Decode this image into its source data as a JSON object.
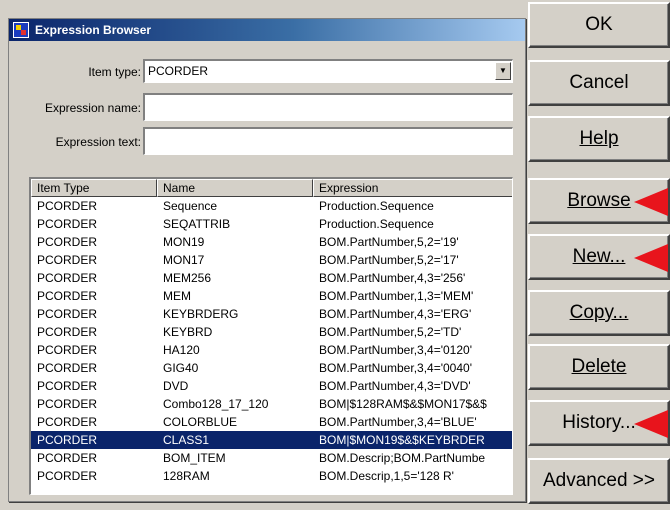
{
  "window": {
    "title": "Expression Browser"
  },
  "form": {
    "item_type_label": "Item type:",
    "item_type_value": "PCORDER",
    "expression_name_label": "Expression name:",
    "expression_name_value": "",
    "expression_text_label": "Expression text:",
    "expression_text_value": ""
  },
  "list": {
    "columns": [
      "Item Type",
      "Name",
      "Expression"
    ],
    "rows": [
      [
        "PCORDER",
        "Sequence",
        "Production.Sequence"
      ],
      [
        "PCORDER",
        "SEQATTRIB",
        "Production.Sequence"
      ],
      [
        "PCORDER",
        "MON19",
        "BOM.PartNumber,5,2='19'"
      ],
      [
        "PCORDER",
        "MON17",
        "BOM.PartNumber,5,2='17'"
      ],
      [
        "PCORDER",
        "MEM256",
        "BOM.PartNumber,4,3='256'"
      ],
      [
        "PCORDER",
        "MEM",
        "BOM.PartNumber,1,3='MEM'"
      ],
      [
        "PCORDER",
        "KEYBRDERG",
        "BOM.PartNumber,4,3='ERG'"
      ],
      [
        "PCORDER",
        "KEYBRD",
        "BOM.PartNumber,5,2='TD'"
      ],
      [
        "PCORDER",
        "HA120",
        "BOM.PartNumber,3,4='0120'"
      ],
      [
        "PCORDER",
        "GIG40",
        "BOM.PartNumber,3,4='0040'"
      ],
      [
        "PCORDER",
        "DVD",
        "BOM.PartNumber,4,3='DVD'"
      ],
      [
        "PCORDER",
        "Combo128_17_120",
        "BOM|$128RAM$&$MON17$&$"
      ],
      [
        "PCORDER",
        "COLORBLUE",
        "BOM.PartNumber,3,4='BLUE'"
      ],
      [
        "PCORDER",
        "CLASS1",
        "BOM|$MON19$&$KEYBRDER"
      ],
      [
        "PCORDER",
        "BOM_ITEM",
        "BOM.Descrip;BOM.PartNumbe"
      ],
      [
        "PCORDER",
        "128RAM",
        "BOM.Descrip,1,5='128 R'"
      ]
    ],
    "selected_row": 13
  },
  "buttons": {
    "ok": "OK",
    "cancel": "Cancel",
    "help": "Help",
    "browse": "Browse",
    "new": "New...",
    "copy": "Copy...",
    "delete": "Delete",
    "history": "History...",
    "advanced": "Advanced >>"
  },
  "colors": {
    "annotation_arrow": "#e8141c",
    "selection": "#0a246a",
    "face": "#d4d0c8"
  },
  "icons": {
    "app": "expression-browser-app-icon",
    "dropdown": "chevron-down-icon",
    "annotation": "red-arrow-icon"
  }
}
